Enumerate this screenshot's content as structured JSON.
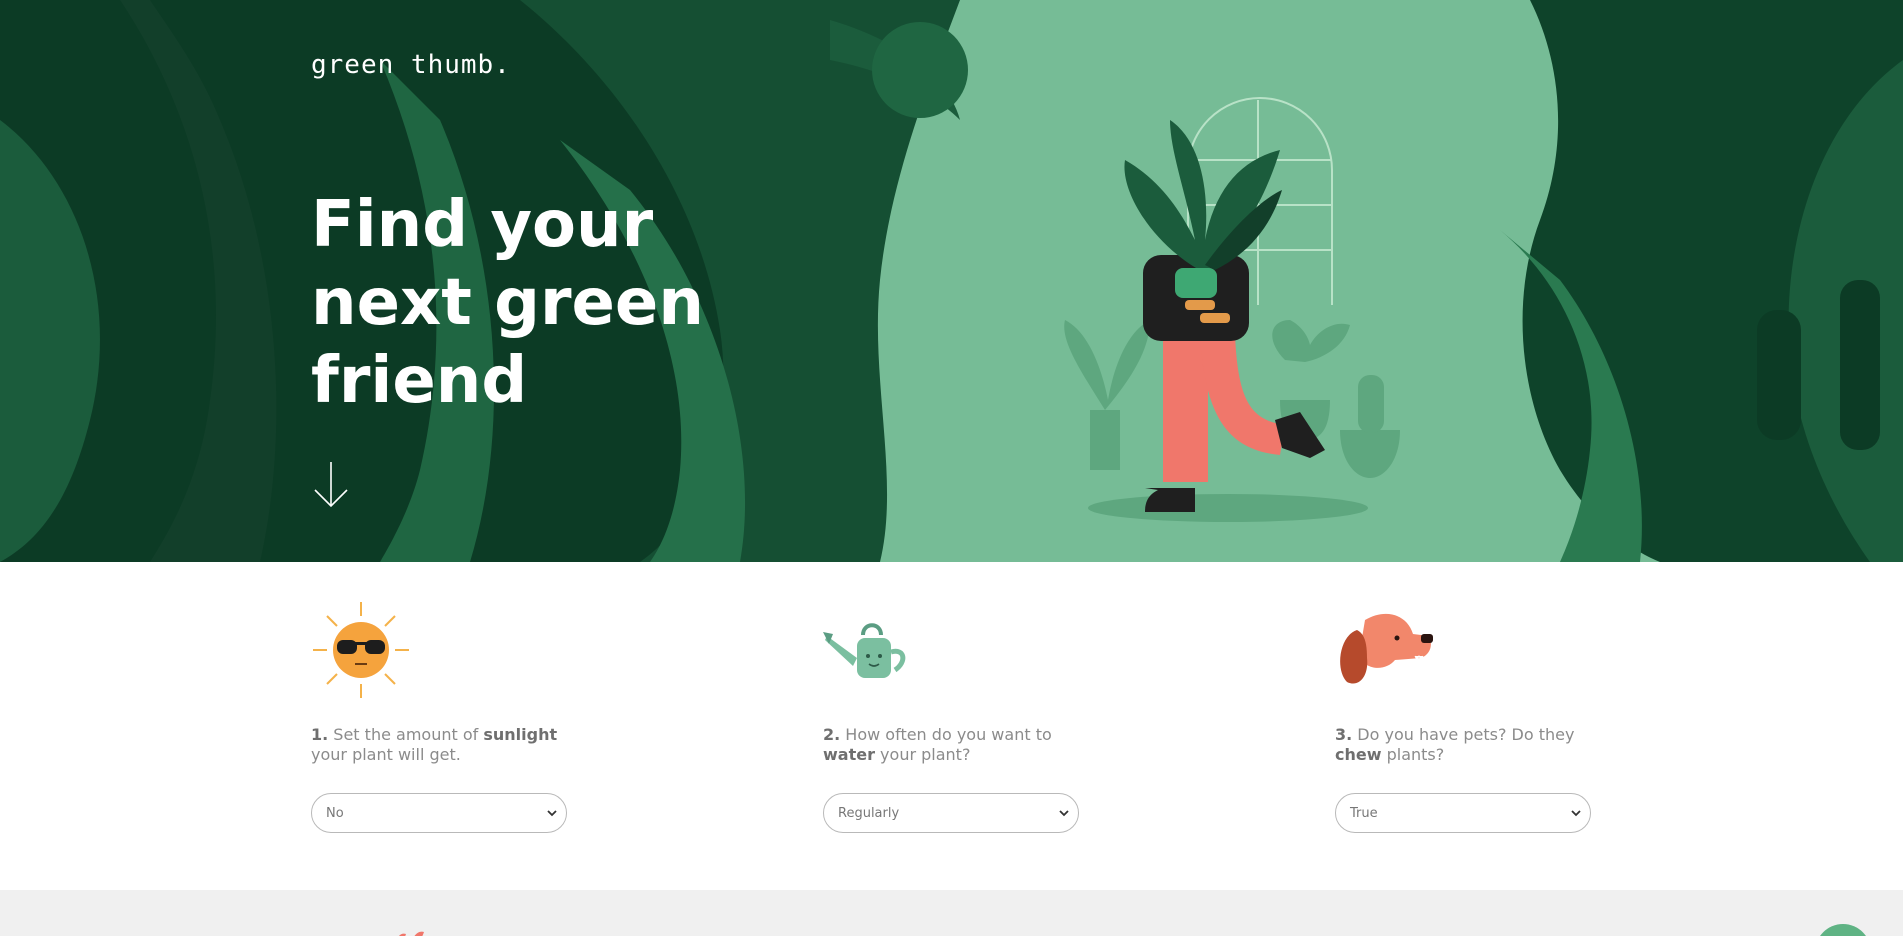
{
  "brand": {
    "logo": "green thumb."
  },
  "hero": {
    "title": "Find your next green friend",
    "scroll_icon": "arrow-down-icon",
    "colors": {
      "background": "#76bc96",
      "dark_leaf": "#0c3b25",
      "mid_leaf": "#1b5c3c",
      "pants": "#f0776b"
    }
  },
  "steps": [
    {
      "icon": "sun-sunglasses-icon",
      "number": "1.",
      "text_before": " Set the amount of ",
      "strong": "sunlight",
      "text_after": " your plant will get.",
      "selected": "No"
    },
    {
      "icon": "watering-can-icon",
      "number": "2.",
      "text_before": " How often do you want to ",
      "strong": "water",
      "text_after": " your plant?",
      "selected": "Regularly"
    },
    {
      "icon": "dog-icon",
      "number": "3.",
      "text_before": " Do you have pets? Do they ",
      "strong": "chew",
      "text_after": " plants?",
      "selected": "True"
    }
  ],
  "footer": {
    "accent": "#5fb384",
    "background": "#f0f0f0"
  }
}
